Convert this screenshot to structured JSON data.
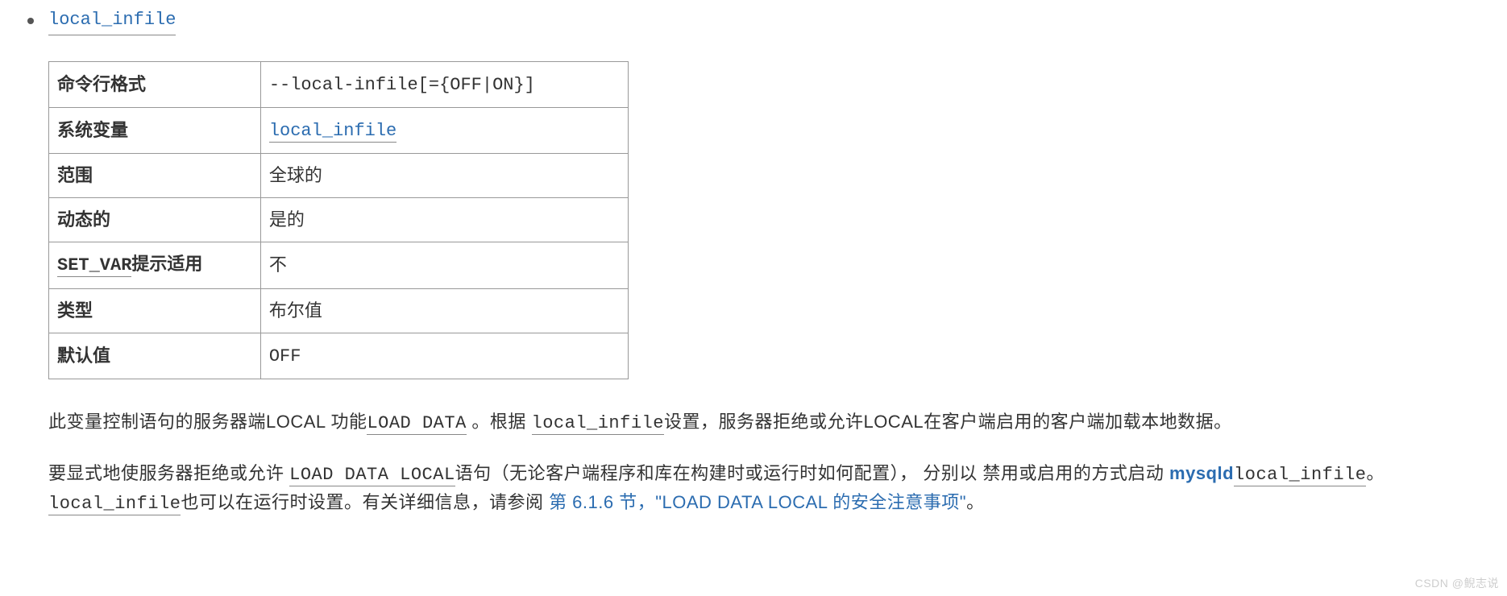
{
  "bullet": {
    "title_code": "local_infile"
  },
  "table": {
    "rows": [
      {
        "label": "命令行格式",
        "label_code": "",
        "value": "--local-infile[={OFF|ON}]",
        "value_is_code": true,
        "value_is_link": false
      },
      {
        "label": "系统变量",
        "label_code": "",
        "value": "local_infile",
        "value_is_code": true,
        "value_is_link": true
      },
      {
        "label": "范围",
        "label_code": "",
        "value": "全球的",
        "value_is_code": false,
        "value_is_link": false
      },
      {
        "label": "动态的",
        "label_code": "",
        "value": "是的",
        "value_is_code": false,
        "value_is_link": false
      },
      {
        "label": "提示适用",
        "label_code": "SET_VAR",
        "value": "不",
        "value_is_code": false,
        "value_is_link": false
      },
      {
        "label": "类型",
        "label_code": "",
        "value": "布尔值",
        "value_is_code": false,
        "value_is_link": false
      },
      {
        "label": "默认值",
        "label_code": "",
        "value": "OFF",
        "value_is_code": true,
        "value_is_link": false
      }
    ]
  },
  "p1": {
    "t1": "此变量控制语句的服务器端LOCAL 功能",
    "c1": "LOAD DATA",
    "t2": " 。根据 ",
    "c2": "local_infile",
    "t3": "设置，服务器拒绝或允许LOCAL在客户端启用的客户端加载本地数据。"
  },
  "p2": {
    "t1": "要显式地使服务器拒绝或允许 ",
    "c1": "LOAD DATA LOCAL",
    "t2": "语句（无论客户端程序和库在构建时或运行时如何配置）， 分别以 禁用或启用的方式启动 ",
    "link_bold": "mysqld",
    "c2": "local_infile",
    "t3": "。 ",
    "c3": "local_infile",
    "t4": "也可以在运行时设置。有关详细信息，请参阅 ",
    "link2": "第 6.1.6 节，\"LOAD DATA LOCAL 的安全注意事项\"",
    "t5": "。"
  },
  "watermark": "CSDN @鲵志说"
}
